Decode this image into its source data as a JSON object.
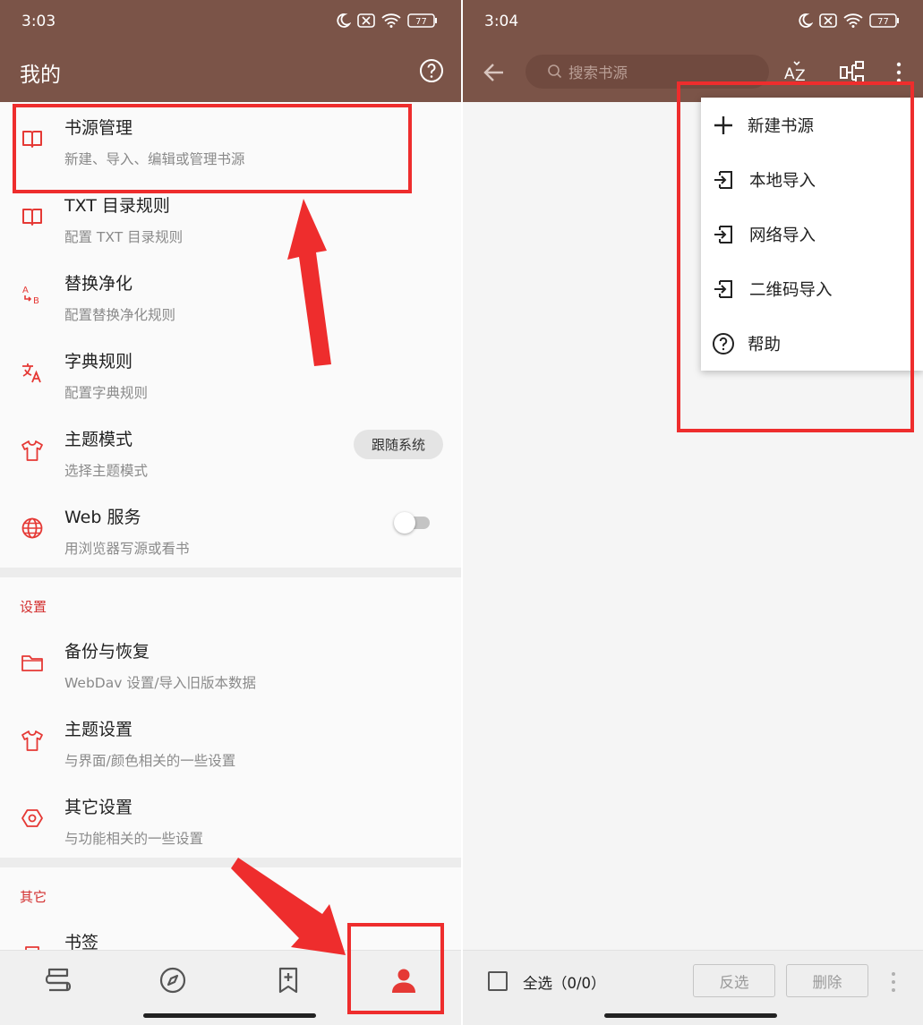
{
  "left": {
    "status": {
      "time": "3:03",
      "battery": "77"
    },
    "toolbar": {
      "title": "我的"
    },
    "items": [
      {
        "title": "书源管理",
        "subtitle": "新建、导入、编辑或管理书源",
        "icon": "book-open-icon"
      },
      {
        "title": "TXT 目录规则",
        "subtitle": "配置 TXT 目录规则",
        "icon": "book-open-icon"
      },
      {
        "title": "替换净化",
        "subtitle": "配置替换净化规则",
        "icon": "replace-ab-icon"
      },
      {
        "title": "字典规则",
        "subtitle": "配置字典规则",
        "icon": "translate-icon"
      },
      {
        "title": "主题模式",
        "subtitle": "选择主题模式",
        "icon": "tshirt-icon",
        "chip": "跟随系统"
      },
      {
        "title": "Web 服务",
        "subtitle": "用浏览器写源或看书",
        "icon": "globe-icon",
        "switch_on": false
      }
    ],
    "settings_section": {
      "label": "设置",
      "items": [
        {
          "title": "备份与恢复",
          "subtitle": "WebDav 设置/导入旧版本数据",
          "icon": "folder-icon"
        },
        {
          "title": "主题设置",
          "subtitle": "与界面/颜色相关的一些设置",
          "icon": "tshirt-icon"
        },
        {
          "title": "其它设置",
          "subtitle": "与功能相关的一些设置",
          "icon": "hexagon-gear-icon"
        }
      ]
    },
    "other_section": {
      "label": "其它",
      "items": [
        {
          "title": "书签",
          "icon": "bookmark-icon"
        }
      ]
    },
    "bottom_nav": [
      "bookshelf-icon",
      "compass-icon",
      "bookmark-plus-icon",
      "person-icon"
    ],
    "bottom_nav_active": 3
  },
  "right": {
    "status": {
      "time": "3:04",
      "battery": "77"
    },
    "search": {
      "placeholder": "搜索书源"
    },
    "toolbar_icons": [
      "sort-az-icon",
      "group-icon",
      "more-vert-icon"
    ],
    "menu": [
      {
        "label": "新建书源",
        "icon": "plus-icon"
      },
      {
        "label": "本地导入",
        "icon": "import-icon"
      },
      {
        "label": "网络导入",
        "icon": "import-icon"
      },
      {
        "label": "二维码导入",
        "icon": "import-icon"
      },
      {
        "label": "帮助",
        "icon": "help-circle-icon"
      }
    ],
    "bottom_bar": {
      "select_all": "全选（0/0）",
      "invert": "反选",
      "delete": "删除"
    }
  },
  "colors": {
    "toolbar": "#7b5448",
    "accent": "#e53935",
    "highlight": "#ee2d2d"
  }
}
